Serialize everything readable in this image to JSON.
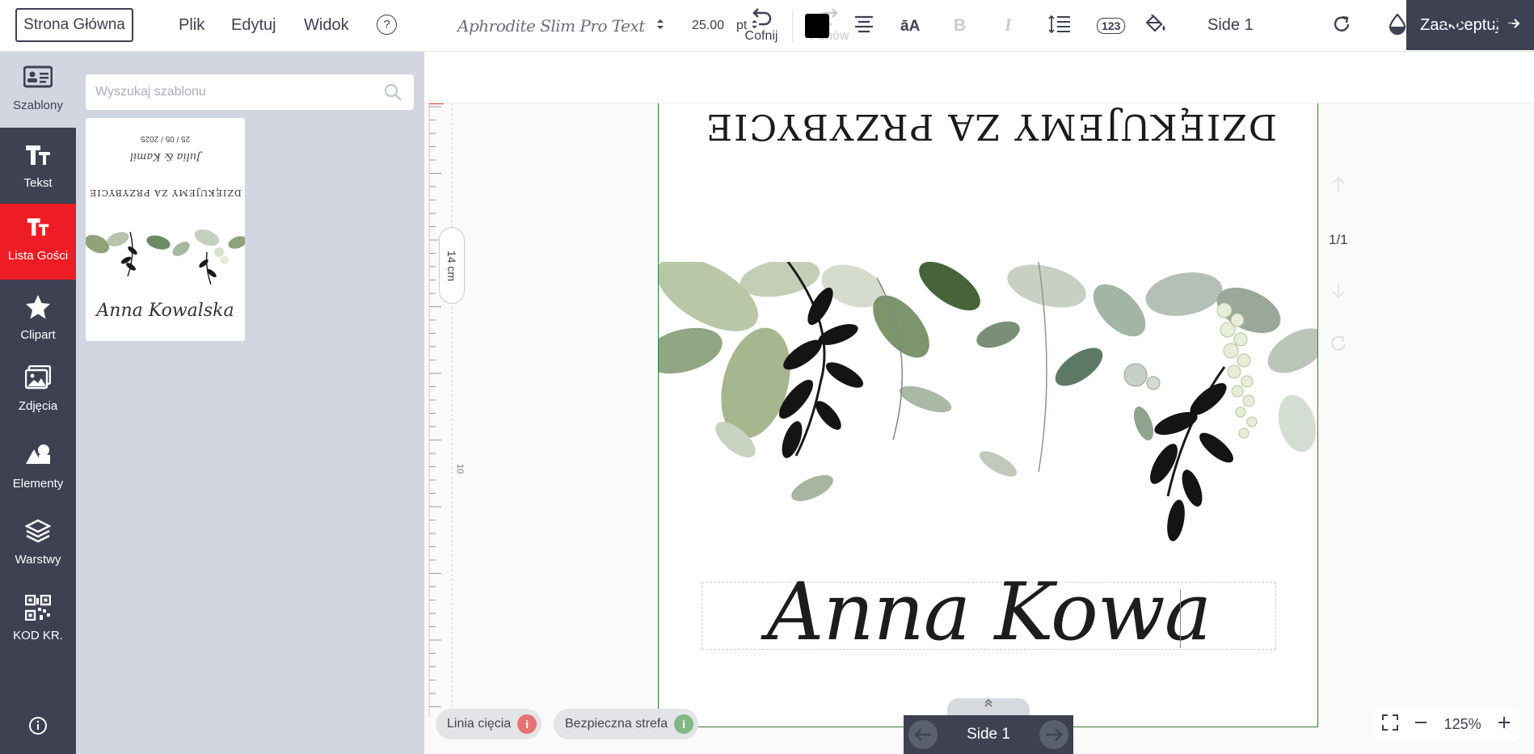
{
  "topbar": {
    "home_label": "Strona Główna",
    "menu": [
      "Plik",
      "Edytuj",
      "Widok"
    ],
    "help_label": "?",
    "undo_label": "Cofnij",
    "redo_label": "Ponów",
    "side_title": "Side 1",
    "accept_label": "Zaakceptuj"
  },
  "nav": {
    "items": [
      {
        "label": "Szablony",
        "icon": "templates-icon"
      },
      {
        "label": "Tekst",
        "icon": "text-icon"
      },
      {
        "label": "Lista Gości",
        "icon": "guest-list-icon"
      },
      {
        "label": "Clipart",
        "icon": "star-icon"
      },
      {
        "label": "Zdjęcia",
        "icon": "image-icon"
      },
      {
        "label": "Elementy",
        "icon": "shapes-icon"
      },
      {
        "label": "Warstwy",
        "icon": "layers-icon"
      },
      {
        "label": "KOD KR.",
        "icon": "qr-code-icon"
      }
    ],
    "active_color": "#ee1c24"
  },
  "panel": {
    "search_placeholder": "Wyszukaj szablonu",
    "template": {
      "date": "25 / 05 / 2025",
      "couple": "Julia & Kamil",
      "thanks": "DZIĘKUJEMY ZA PRZYBYCIE",
      "name": "Anna Kowalska"
    }
  },
  "toolbar": {
    "font_name": "Aphrodite Slim Pro Text",
    "font_size": "25.00",
    "unit": "pt",
    "color": "#000000",
    "numbers_label": "123"
  },
  "canvas": {
    "ruler_label": "14 cm",
    "ruler_mark": "10",
    "upside_text": "DZIĘKUJEMY ZA PRZYBYCIE",
    "name_text": "Anna Kowa",
    "page_count": "1/1"
  },
  "bottom": {
    "cut_line_label": "Linia cięcia",
    "safe_zone_label": "Bezpieczna strefa",
    "side_label": "Side 1",
    "zoom": "125%"
  }
}
